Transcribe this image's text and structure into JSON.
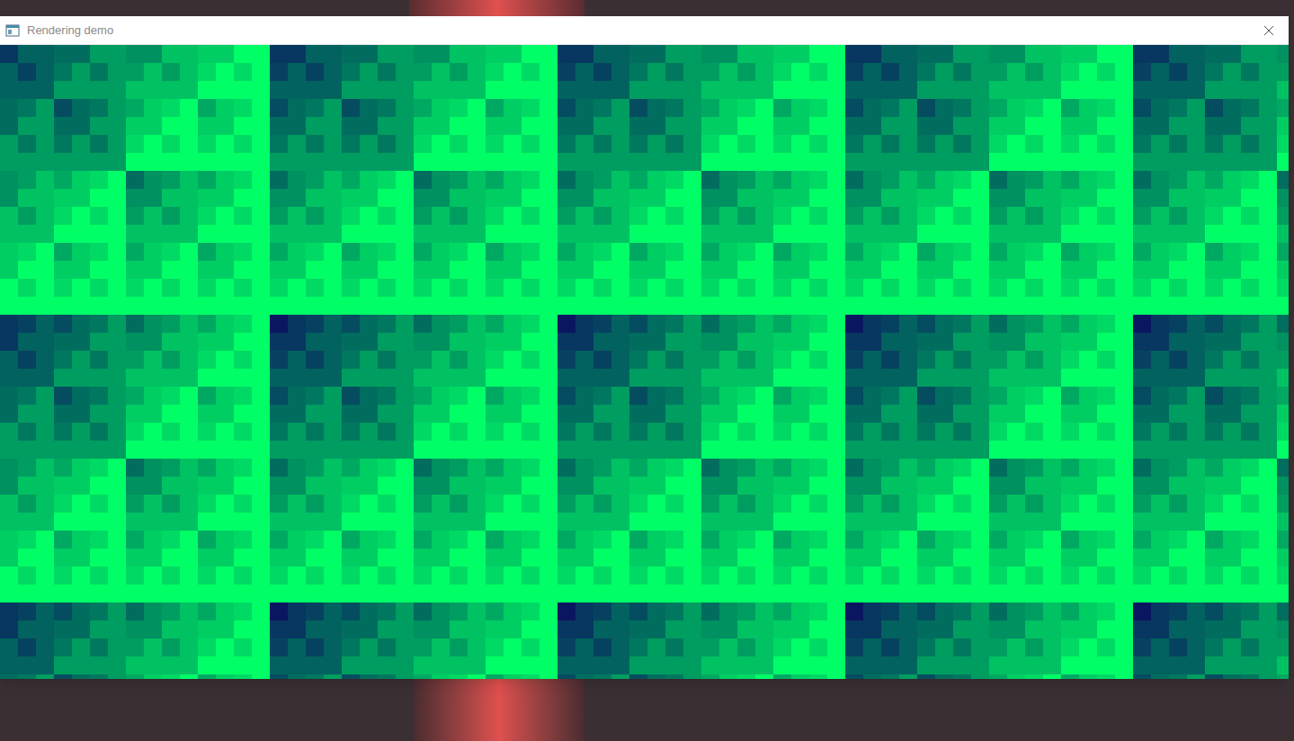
{
  "window": {
    "title": "Rendering demo"
  }
}
